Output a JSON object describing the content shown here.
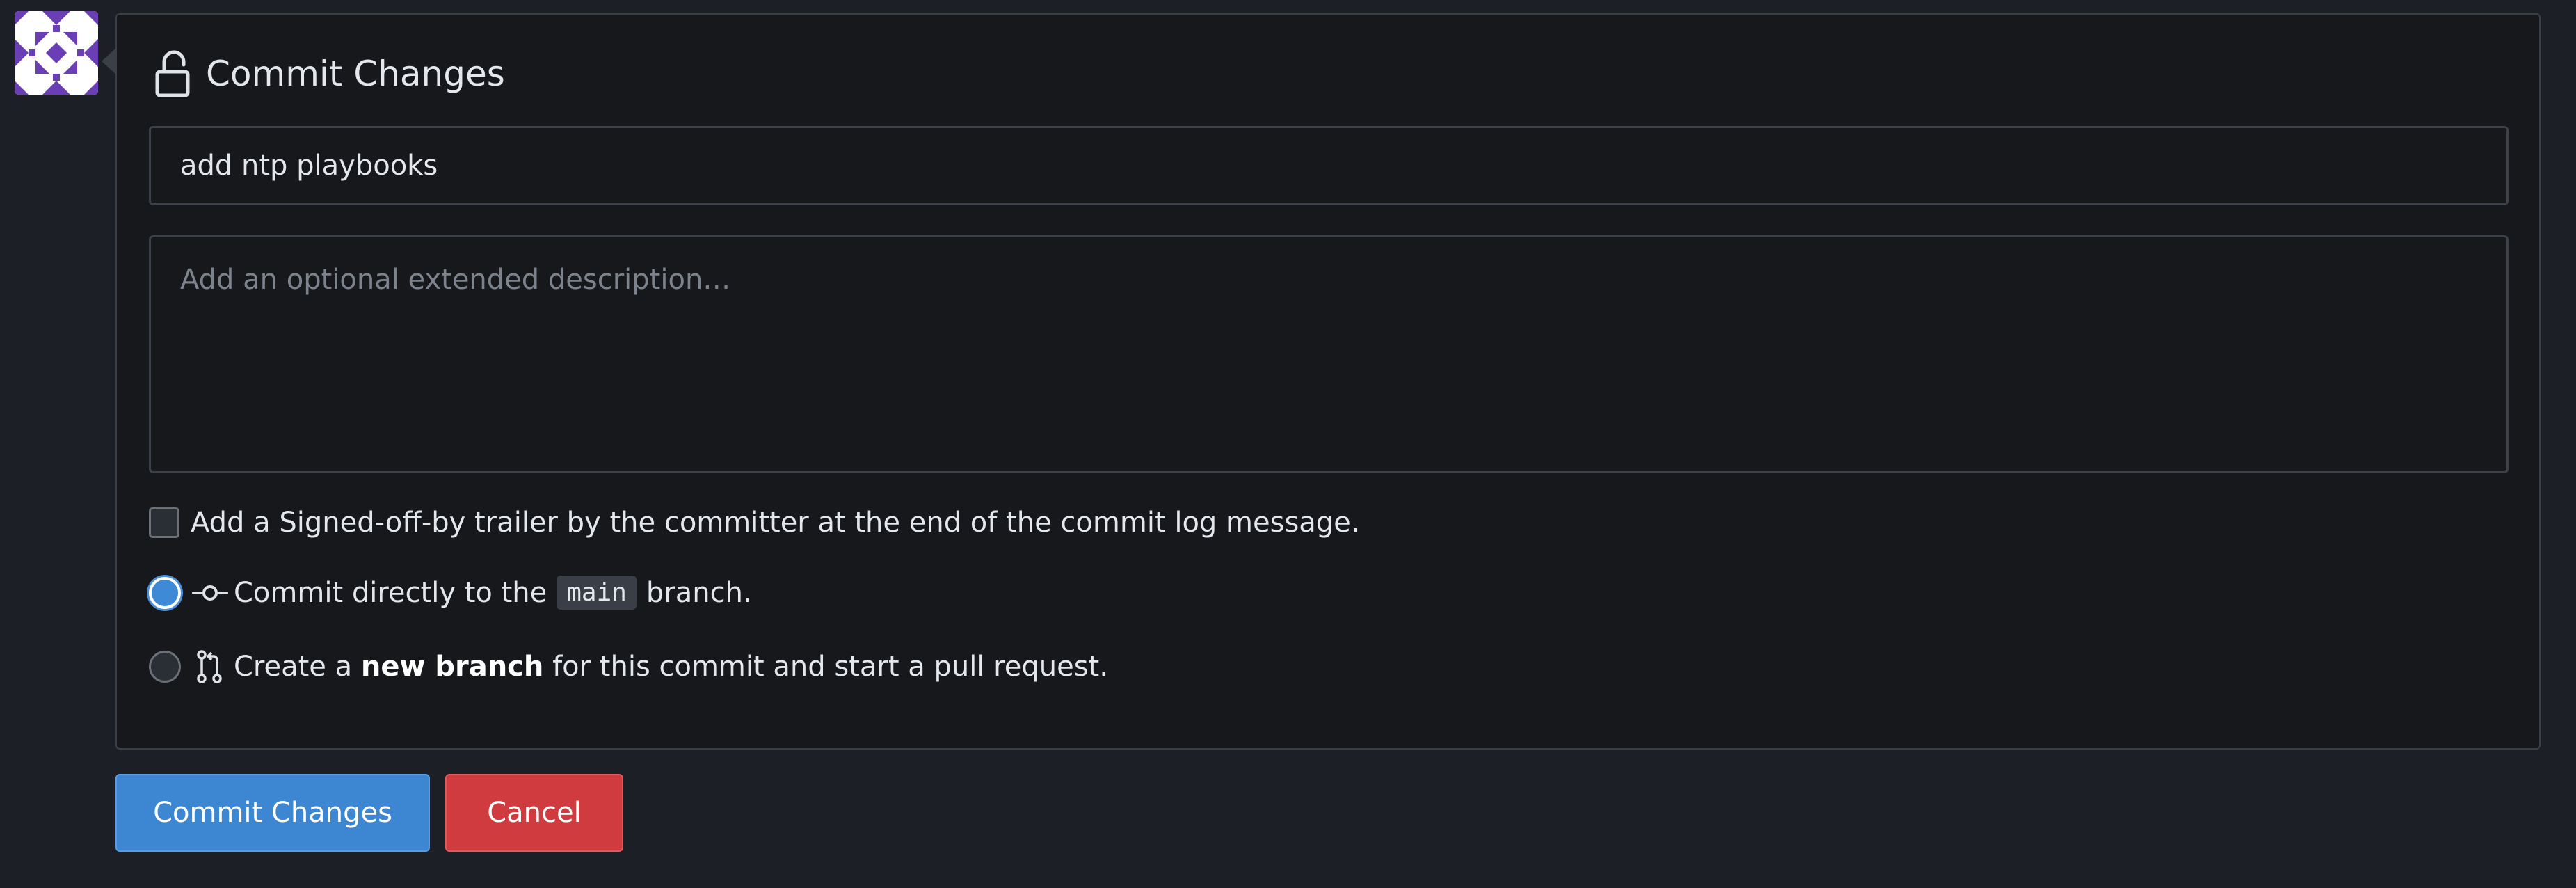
{
  "header": {
    "title": "Commit Changes",
    "icon": "unlock-icon"
  },
  "commit_form": {
    "summary_value": "add ntp playbooks",
    "description_placeholder": "Add an optional extended description…",
    "signoff_label": "Add a Signed-off-by trailer by the committer at the end of the commit log message.",
    "signoff_checked": false,
    "direct_commit": {
      "prefix": "Commit directly to the",
      "branch": "main",
      "suffix": "branch.",
      "selected": true
    },
    "new_branch": {
      "prefix": "Create a",
      "bold": "new branch",
      "suffix": "for this commit and start a pull request.",
      "selected": false
    }
  },
  "actions": {
    "commit_label": "Commit Changes",
    "cancel_label": "Cancel"
  },
  "colors": {
    "primary": "#3c86d2",
    "danger": "#d03b3f",
    "avatar_accent": "#6a3fb5"
  }
}
